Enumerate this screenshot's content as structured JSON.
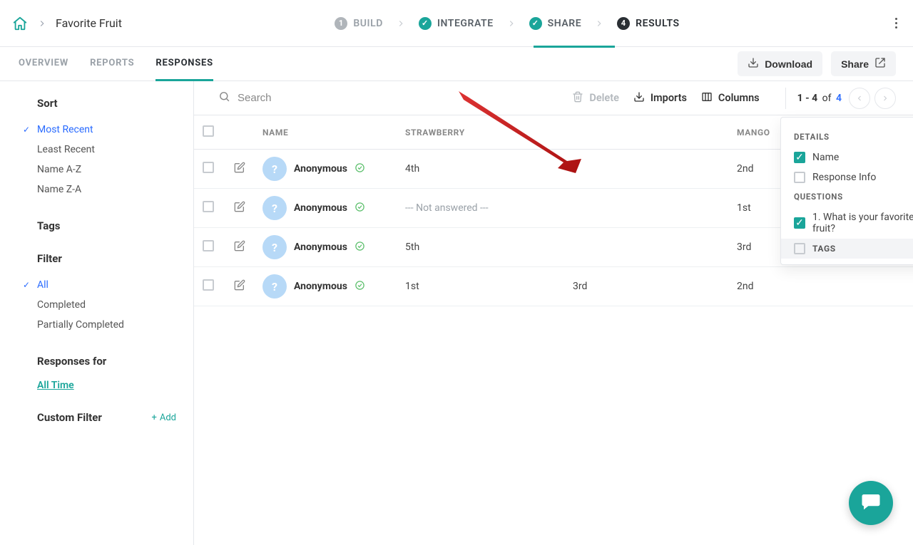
{
  "header": {
    "page_title": "Favorite Fruit",
    "steps": [
      {
        "num": "1",
        "label": "BUILD",
        "state": "grey"
      },
      {
        "num": "✓",
        "label": "INTEGRATE",
        "state": "teal"
      },
      {
        "num": "✓",
        "label": "SHARE",
        "state": "teal"
      },
      {
        "num": "4",
        "label": "RESULTS",
        "state": "black"
      }
    ]
  },
  "subtabs": {
    "items": [
      "OVERVIEW",
      "REPORTS",
      "RESPONSES"
    ],
    "active": "RESPONSES",
    "download_label": "Download",
    "share_label": "Share"
  },
  "sidebar": {
    "sort": {
      "heading": "Sort",
      "items": [
        "Most Recent",
        "Least Recent",
        "Name A-Z",
        "Name Z-A"
      ],
      "selected": "Most Recent"
    },
    "tags": {
      "heading": "Tags"
    },
    "filter": {
      "heading": "Filter",
      "items": [
        "All",
        "Completed",
        "Partially Completed"
      ],
      "selected": "All"
    },
    "responses_for": {
      "heading": "Responses for",
      "link": "All Time"
    },
    "custom_filter": {
      "heading": "Custom Filter",
      "add_label": "Add"
    }
  },
  "toolbar": {
    "search_placeholder": "Search",
    "delete_label": "Delete",
    "imports_label": "Imports",
    "columns_label": "Columns",
    "pager_range": "1 - 4",
    "pager_of": "of",
    "pager_total": "4"
  },
  "table": {
    "headers": {
      "name": "NAME",
      "strawberry": "STRAWBERRY",
      "mango": "MANGO"
    },
    "not_answered": "--- Not answered ---",
    "anonymous": "Anonymous",
    "rows": [
      {
        "name": "Anonymous",
        "strawberry": "4th",
        "mango": "2nd"
      },
      {
        "name": "Anonymous",
        "strawberry": "--- Not answered ---",
        "mango": "1st"
      },
      {
        "name": "Anonymous",
        "strawberry": "5th",
        "mango": "3rd"
      },
      {
        "name": "Anonymous",
        "strawberry": "1st",
        "hidden_col": "3rd",
        "mango": "2nd"
      }
    ]
  },
  "popover": {
    "details_label": "DETAILS",
    "name_label": "Name",
    "response_info_label": "Response Info",
    "questions_label": "QUESTIONS",
    "q1_label": "1. What is your favorite fruit?",
    "tags_label": "TAGS"
  }
}
